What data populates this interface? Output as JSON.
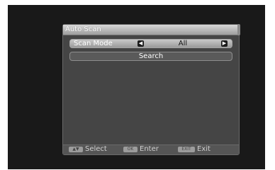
{
  "window": {
    "title": "Auto Scan"
  },
  "scan_mode": {
    "label": "Scan Mode",
    "value": "All",
    "left_arrow": "chevron-left-icon",
    "right_arrow": "chevron-right-icon"
  },
  "search": {
    "label": "Search"
  },
  "footer": {
    "select": {
      "key_icon": "up-down-arrows-icon",
      "label": "Select"
    },
    "enter": {
      "key": "OK",
      "label": "Enter"
    },
    "exit": {
      "key": "EXIT",
      "label": "Exit"
    }
  },
  "colors": {
    "panel": "#454545",
    "screen": "#191919",
    "highlight_row": "#c9c9c9"
  }
}
